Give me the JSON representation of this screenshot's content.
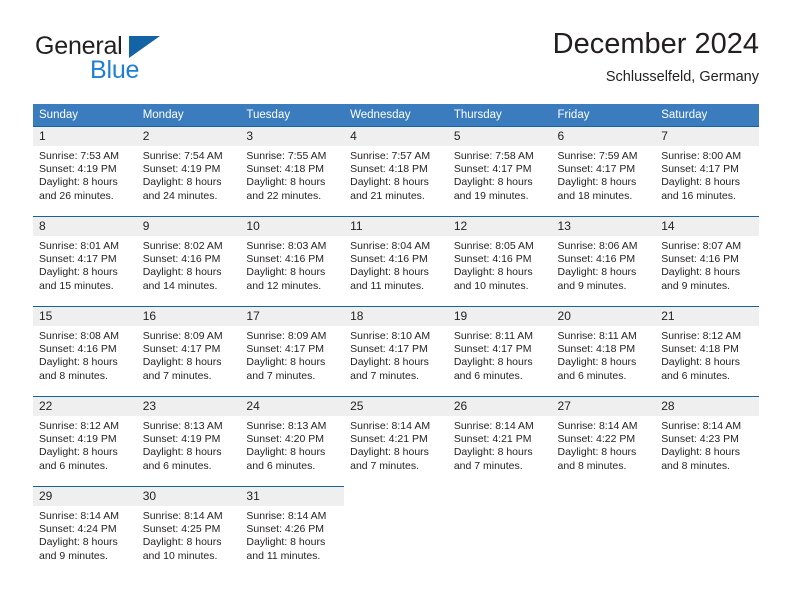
{
  "brand": {
    "name_part1": "General",
    "name_part2": "Blue",
    "logo_icon": "triangle-logo-icon"
  },
  "header": {
    "title": "December 2024",
    "location": "Schlusselfeld, Germany"
  },
  "calendar": {
    "weekday_headers": [
      "Sunday",
      "Monday",
      "Tuesday",
      "Wednesday",
      "Thursday",
      "Friday",
      "Saturday"
    ],
    "header_bg": "#3a7cbe",
    "daynum_bg": "#efefef",
    "cell_top_border": "#1464a5",
    "weeks": [
      [
        {
          "day": "1",
          "sunrise": "Sunrise: 7:53 AM",
          "sunset": "Sunset: 4:19 PM",
          "daylight1": "Daylight: 8 hours",
          "daylight2": "and 26 minutes."
        },
        {
          "day": "2",
          "sunrise": "Sunrise: 7:54 AM",
          "sunset": "Sunset: 4:19 PM",
          "daylight1": "Daylight: 8 hours",
          "daylight2": "and 24 minutes."
        },
        {
          "day": "3",
          "sunrise": "Sunrise: 7:55 AM",
          "sunset": "Sunset: 4:18 PM",
          "daylight1": "Daylight: 8 hours",
          "daylight2": "and 22 minutes."
        },
        {
          "day": "4",
          "sunrise": "Sunrise: 7:57 AM",
          "sunset": "Sunset: 4:18 PM",
          "daylight1": "Daylight: 8 hours",
          "daylight2": "and 21 minutes."
        },
        {
          "day": "5",
          "sunrise": "Sunrise: 7:58 AM",
          "sunset": "Sunset: 4:17 PM",
          "daylight1": "Daylight: 8 hours",
          "daylight2": "and 19 minutes."
        },
        {
          "day": "6",
          "sunrise": "Sunrise: 7:59 AM",
          "sunset": "Sunset: 4:17 PM",
          "daylight1": "Daylight: 8 hours",
          "daylight2": "and 18 minutes."
        },
        {
          "day": "7",
          "sunrise": "Sunrise: 8:00 AM",
          "sunset": "Sunset: 4:17 PM",
          "daylight1": "Daylight: 8 hours",
          "daylight2": "and 16 minutes."
        }
      ],
      [
        {
          "day": "8",
          "sunrise": "Sunrise: 8:01 AM",
          "sunset": "Sunset: 4:17 PM",
          "daylight1": "Daylight: 8 hours",
          "daylight2": "and 15 minutes."
        },
        {
          "day": "9",
          "sunrise": "Sunrise: 8:02 AM",
          "sunset": "Sunset: 4:16 PM",
          "daylight1": "Daylight: 8 hours",
          "daylight2": "and 14 minutes."
        },
        {
          "day": "10",
          "sunrise": "Sunrise: 8:03 AM",
          "sunset": "Sunset: 4:16 PM",
          "daylight1": "Daylight: 8 hours",
          "daylight2": "and 12 minutes."
        },
        {
          "day": "11",
          "sunrise": "Sunrise: 8:04 AM",
          "sunset": "Sunset: 4:16 PM",
          "daylight1": "Daylight: 8 hours",
          "daylight2": "and 11 minutes."
        },
        {
          "day": "12",
          "sunrise": "Sunrise: 8:05 AM",
          "sunset": "Sunset: 4:16 PM",
          "daylight1": "Daylight: 8 hours",
          "daylight2": "and 10 minutes."
        },
        {
          "day": "13",
          "sunrise": "Sunrise: 8:06 AM",
          "sunset": "Sunset: 4:16 PM",
          "daylight1": "Daylight: 8 hours",
          "daylight2": "and 9 minutes."
        },
        {
          "day": "14",
          "sunrise": "Sunrise: 8:07 AM",
          "sunset": "Sunset: 4:16 PM",
          "daylight1": "Daylight: 8 hours",
          "daylight2": "and 9 minutes."
        }
      ],
      [
        {
          "day": "15",
          "sunrise": "Sunrise: 8:08 AM",
          "sunset": "Sunset: 4:16 PM",
          "daylight1": "Daylight: 8 hours",
          "daylight2": "and 8 minutes."
        },
        {
          "day": "16",
          "sunrise": "Sunrise: 8:09 AM",
          "sunset": "Sunset: 4:17 PM",
          "daylight1": "Daylight: 8 hours",
          "daylight2": "and 7 minutes."
        },
        {
          "day": "17",
          "sunrise": "Sunrise: 8:09 AM",
          "sunset": "Sunset: 4:17 PM",
          "daylight1": "Daylight: 8 hours",
          "daylight2": "and 7 minutes."
        },
        {
          "day": "18",
          "sunrise": "Sunrise: 8:10 AM",
          "sunset": "Sunset: 4:17 PM",
          "daylight1": "Daylight: 8 hours",
          "daylight2": "and 7 minutes."
        },
        {
          "day": "19",
          "sunrise": "Sunrise: 8:11 AM",
          "sunset": "Sunset: 4:17 PM",
          "daylight1": "Daylight: 8 hours",
          "daylight2": "and 6 minutes."
        },
        {
          "day": "20",
          "sunrise": "Sunrise: 8:11 AM",
          "sunset": "Sunset: 4:18 PM",
          "daylight1": "Daylight: 8 hours",
          "daylight2": "and 6 minutes."
        },
        {
          "day": "21",
          "sunrise": "Sunrise: 8:12 AM",
          "sunset": "Sunset: 4:18 PM",
          "daylight1": "Daylight: 8 hours",
          "daylight2": "and 6 minutes."
        }
      ],
      [
        {
          "day": "22",
          "sunrise": "Sunrise: 8:12 AM",
          "sunset": "Sunset: 4:19 PM",
          "daylight1": "Daylight: 8 hours",
          "daylight2": "and 6 minutes."
        },
        {
          "day": "23",
          "sunrise": "Sunrise: 8:13 AM",
          "sunset": "Sunset: 4:19 PM",
          "daylight1": "Daylight: 8 hours",
          "daylight2": "and 6 minutes."
        },
        {
          "day": "24",
          "sunrise": "Sunrise: 8:13 AM",
          "sunset": "Sunset: 4:20 PM",
          "daylight1": "Daylight: 8 hours",
          "daylight2": "and 6 minutes."
        },
        {
          "day": "25",
          "sunrise": "Sunrise: 8:14 AM",
          "sunset": "Sunset: 4:21 PM",
          "daylight1": "Daylight: 8 hours",
          "daylight2": "and 7 minutes."
        },
        {
          "day": "26",
          "sunrise": "Sunrise: 8:14 AM",
          "sunset": "Sunset: 4:21 PM",
          "daylight1": "Daylight: 8 hours",
          "daylight2": "and 7 minutes."
        },
        {
          "day": "27",
          "sunrise": "Sunrise: 8:14 AM",
          "sunset": "Sunset: 4:22 PM",
          "daylight1": "Daylight: 8 hours",
          "daylight2": "and 8 minutes."
        },
        {
          "day": "28",
          "sunrise": "Sunrise: 8:14 AM",
          "sunset": "Sunset: 4:23 PM",
          "daylight1": "Daylight: 8 hours",
          "daylight2": "and 8 minutes."
        }
      ],
      [
        {
          "day": "29",
          "sunrise": "Sunrise: 8:14 AM",
          "sunset": "Sunset: 4:24 PM",
          "daylight1": "Daylight: 8 hours",
          "daylight2": "and 9 minutes."
        },
        {
          "day": "30",
          "sunrise": "Sunrise: 8:14 AM",
          "sunset": "Sunset: 4:25 PM",
          "daylight1": "Daylight: 8 hours",
          "daylight2": "and 10 minutes."
        },
        {
          "day": "31",
          "sunrise": "Sunrise: 8:14 AM",
          "sunset": "Sunset: 4:26 PM",
          "daylight1": "Daylight: 8 hours",
          "daylight2": "and 11 minutes."
        },
        {
          "day": "",
          "sunrise": "",
          "sunset": "",
          "daylight1": "",
          "daylight2": ""
        },
        {
          "day": "",
          "sunrise": "",
          "sunset": "",
          "daylight1": "",
          "daylight2": ""
        },
        {
          "day": "",
          "sunrise": "",
          "sunset": "",
          "daylight1": "",
          "daylight2": ""
        },
        {
          "day": "",
          "sunrise": "",
          "sunset": "",
          "daylight1": "",
          "daylight2": ""
        }
      ]
    ]
  }
}
